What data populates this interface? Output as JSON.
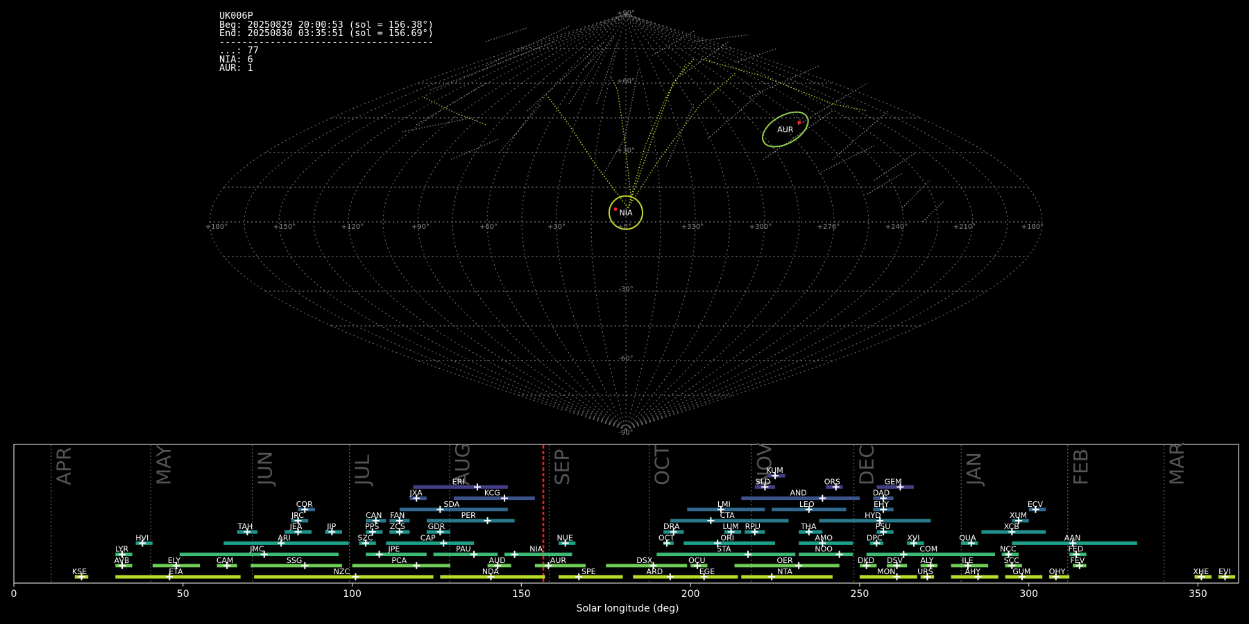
{
  "header": {
    "station": "UK006P",
    "begin": "Beg: 20250829 20:00:53 (sol = 156.38°)",
    "end": "End: 20250830 03:35:51 (sol = 156.69°)",
    "separator": "--------------------------------------",
    "counts": [
      {
        "label": "...",
        "value": 77
      },
      {
        "label": "NIA",
        "value": 6
      },
      {
        "label": "AUR",
        "value": 1
      }
    ]
  },
  "chart_data": [
    {
      "type": "scatter",
      "projection": "sinusoidal",
      "lon_ticks": [
        "+180°",
        "+150°",
        "+120°",
        "+90°",
        "+60°",
        "+30°",
        "+0°",
        "+330°",
        "+300°",
        "+270°",
        "+240°",
        "+210°",
        "+180°"
      ],
      "lat_ticks": [
        "+90°",
        "+60°",
        "+30°",
        "-30°",
        "-60°",
        "-90°"
      ],
      "radiants": [
        {
          "name": "AUR",
          "lon": 90,
          "lat": 40,
          "color": "#8fd14f"
        },
        {
          "name": "NIA",
          "lon": 0,
          "lat": 4,
          "color": "#c8d62a"
        }
      ],
      "colors": {
        "trails_sporadic": "#8a8a8a",
        "trails_nia": "#c8d62a",
        "trails_aur": "#8fd14f",
        "start_point": "#ff2020"
      }
    },
    {
      "type": "timeline",
      "xlabel": "Solar longitude (deg)",
      "xlim": [
        0,
        362
      ],
      "xticks": [
        0,
        50,
        100,
        150,
        200,
        250,
        300,
        350
      ],
      "current_sol": 156.5,
      "months": [
        {
          "label": "APR",
          "start": 11
        },
        {
          "label": "MAY",
          "start": 40.5
        },
        {
          "label": "JUN",
          "start": 70.5
        },
        {
          "label": "JUL",
          "start": 99.2
        },
        {
          "label": "AUG",
          "start": 128.8
        },
        {
          "label": "SEP",
          "start": 158.2
        },
        {
          "label": "OCT",
          "start": 187.8
        },
        {
          "label": "NOV",
          "start": 218
        },
        {
          "label": "DEC",
          "start": 248.3
        },
        {
          "label": "JAN",
          "start": 280
        },
        {
          "label": "FEB",
          "start": 311.5
        },
        {
          "label": "MAR",
          "start": 340
        }
      ],
      "showers": [
        {
          "code": "KUM",
          "start": 223,
          "end": 228,
          "peak": 225,
          "row": 8,
          "color": "#433e85"
        },
        {
          "code": "ERI",
          "start": 118,
          "end": 146,
          "peak": 137,
          "row": 7,
          "color": "#433e85"
        },
        {
          "code": "SLD",
          "start": 219,
          "end": 225,
          "peak": 222,
          "row": 7,
          "color": "#433e85"
        },
        {
          "code": "ORS",
          "start": 240,
          "end": 245,
          "peak": 243,
          "row": 7,
          "color": "#433e85"
        },
        {
          "code": "GEM",
          "start": 255,
          "end": 266,
          "peak": 262,
          "row": 7,
          "color": "#433e85"
        },
        {
          "code": "JXA",
          "start": 117,
          "end": 122,
          "peak": 119,
          "row": 6,
          "color": "#3b528b"
        },
        {
          "code": "KCG",
          "start": 130,
          "end": 154,
          "peak": 145,
          "row": 6,
          "color": "#3b528b"
        },
        {
          "code": "AND",
          "start": 215,
          "end": 250,
          "peak": 239,
          "row": 6,
          "color": "#3b528b"
        },
        {
          "code": "DAD",
          "start": 254,
          "end": 260,
          "peak": 257,
          "row": 6,
          "color": "#3b528b"
        },
        {
          "code": "COR",
          "start": 84,
          "end": 89,
          "peak": 86,
          "row": 5,
          "color": "#31688e"
        },
        {
          "code": "SDA",
          "start": 114,
          "end": 146,
          "peak": 126,
          "row": 5,
          "color": "#31688e"
        },
        {
          "code": "LMI",
          "start": 199,
          "end": 222,
          "peak": 209,
          "row": 5,
          "color": "#31688e"
        },
        {
          "code": "LEO",
          "start": 224,
          "end": 246,
          "peak": 235,
          "row": 5,
          "color": "#31688e"
        },
        {
          "code": "EHY",
          "start": 254,
          "end": 260,
          "peak": 257,
          "row": 5,
          "color": "#31688e"
        },
        {
          "code": "ECV",
          "start": 300,
          "end": 305,
          "peak": 302,
          "row": 5,
          "color": "#31688e"
        },
        {
          "code": "JRC",
          "start": 82,
          "end": 87,
          "peak": 84,
          "row": 4,
          "color": "#287c8e"
        },
        {
          "code": "CAN",
          "start": 104,
          "end": 110,
          "peak": 107,
          "row": 4,
          "color": "#287c8e"
        },
        {
          "code": "FAN",
          "start": 111,
          "end": 117,
          "peak": 114,
          "row": 4,
          "color": "#287c8e"
        },
        {
          "code": "PER",
          "start": 122,
          "end": 148,
          "peak": 140,
          "row": 4,
          "color": "#287c8e"
        },
        {
          "code": "CTA",
          "start": 194,
          "end": 229,
          "peak": 206,
          "row": 4,
          "color": "#287c8e"
        },
        {
          "code": "HYD",
          "start": 238,
          "end": 271,
          "peak": 256,
          "row": 4,
          "color": "#287c8e"
        },
        {
          "code": "XUM",
          "start": 295,
          "end": 300,
          "peak": 297,
          "row": 4,
          "color": "#287c8e"
        },
        {
          "code": "TAH",
          "start": 66,
          "end": 72,
          "peak": 69,
          "row": 3,
          "color": "#21918c"
        },
        {
          "code": "JEA",
          "start": 80,
          "end": 88,
          "peak": 84,
          "row": 3,
          "color": "#21918c"
        },
        {
          "code": "JIP",
          "start": 92,
          "end": 97,
          "peak": 94,
          "row": 3,
          "color": "#21918c"
        },
        {
          "code": "PPS",
          "start": 104,
          "end": 109,
          "peak": 106,
          "row": 3,
          "color": "#21918c"
        },
        {
          "code": "ZCS",
          "start": 111,
          "end": 117,
          "peak": 114,
          "row": 3,
          "color": "#21918c"
        },
        {
          "code": "GDR",
          "start": 122,
          "end": 129,
          "peak": 126,
          "row": 3,
          "color": "#21918c"
        },
        {
          "code": "DRA",
          "start": 192,
          "end": 198,
          "peak": 195,
          "row": 3,
          "color": "#21918c"
        },
        {
          "code": "LUM",
          "start": 210,
          "end": 215,
          "peak": 212,
          "row": 3,
          "color": "#21918c"
        },
        {
          "code": "RPU",
          "start": 216,
          "end": 222,
          "peak": 219,
          "row": 3,
          "color": "#21918c"
        },
        {
          "code": "THA",
          "start": 232,
          "end": 239,
          "peak": 235,
          "row": 3,
          "color": "#21918c"
        },
        {
          "code": "PSU",
          "start": 255,
          "end": 260,
          "peak": 257,
          "row": 3,
          "color": "#21918c"
        },
        {
          "code": "XCB",
          "start": 286,
          "end": 305,
          "peak": 295,
          "row": 3,
          "color": "#21918c"
        },
        {
          "code": "HVI",
          "start": 36,
          "end": 41,
          "peak": 38,
          "row": 2,
          "color": "#1fa088"
        },
        {
          "code": "ARI",
          "start": 62,
          "end": 99,
          "peak": 79,
          "row": 2,
          "color": "#1fa088"
        },
        {
          "code": "SZC",
          "start": 102,
          "end": 107,
          "peak": 104,
          "row": 2,
          "color": "#1fa088"
        },
        {
          "code": "CAP",
          "start": 110,
          "end": 136,
          "peak": 127,
          "row": 2,
          "color": "#1fa088"
        },
        {
          "code": "NUE",
          "start": 161,
          "end": 166,
          "peak": 163,
          "row": 2,
          "color": "#1fa088"
        },
        {
          "code": "OCT",
          "start": 192,
          "end": 195,
          "peak": 193,
          "row": 2,
          "color": "#1fa088"
        },
        {
          "code": "ORI",
          "start": 198,
          "end": 225,
          "peak": 208,
          "row": 2,
          "color": "#1fa088"
        },
        {
          "code": "AMO",
          "start": 232,
          "end": 248,
          "peak": 239,
          "row": 2,
          "color": "#1fa088"
        },
        {
          "code": "DPC",
          "start": 253,
          "end": 257,
          "peak": 255,
          "row": 2,
          "color": "#1fa088"
        },
        {
          "code": "XVI",
          "start": 264,
          "end": 269,
          "peak": 266,
          "row": 2,
          "color": "#1fa088"
        },
        {
          "code": "QUA",
          "start": 280,
          "end": 285,
          "peak": 283,
          "row": 2,
          "color": "#1fa088"
        },
        {
          "code": "AAN",
          "start": 295,
          "end": 332,
          "peak": 313,
          "row": 2,
          "color": "#1fa088"
        },
        {
          "code": "LYR",
          "start": 30,
          "end": 35,
          "peak": 32,
          "row": 1,
          "color": "#3bbb75"
        },
        {
          "code": "JMC",
          "start": 49,
          "end": 96,
          "peak": 74,
          "row": 1,
          "color": "#3bbb75"
        },
        {
          "code": "JPE",
          "start": 104,
          "end": 122,
          "peak": 108,
          "row": 1,
          "color": "#3bbb75"
        },
        {
          "code": "PAU",
          "start": 124,
          "end": 143,
          "peak": 136,
          "row": 1,
          "color": "#3bbb75"
        },
        {
          "code": "NIA",
          "start": 145,
          "end": 165,
          "peak": 148,
          "row": 1,
          "color": "#3bbb75"
        },
        {
          "code": "STA",
          "start": 190,
          "end": 231,
          "peak": 217,
          "row": 1,
          "color": "#3bbb75"
        },
        {
          "code": "NOO",
          "start": 232,
          "end": 248,
          "peak": 244,
          "row": 1,
          "color": "#3bbb75"
        },
        {
          "code": "COM",
          "start": 252,
          "end": 290,
          "peak": 263,
          "row": 1,
          "color": "#3bbb75"
        },
        {
          "code": "NCC",
          "start": 292,
          "end": 297,
          "peak": 294,
          "row": 1,
          "color": "#3bbb75"
        },
        {
          "code": "FED",
          "start": 312,
          "end": 317,
          "peak": 314,
          "row": 1,
          "color": "#3bbb75"
        },
        {
          "code": "AVB",
          "start": 30,
          "end": 35,
          "peak": 32,
          "row": 0,
          "color": "#6ece58"
        },
        {
          "code": "ELY",
          "start": 41,
          "end": 55,
          "peak": 48,
          "row": 0,
          "color": "#6ece58"
        },
        {
          "code": "CAM",
          "start": 60,
          "end": 66,
          "peak": 63,
          "row": 0,
          "color": "#6ece58"
        },
        {
          "code": "SSG",
          "start": 70,
          "end": 97,
          "peak": 86,
          "row": 0,
          "color": "#6ece58"
        },
        {
          "code": "PCA",
          "start": 100,
          "end": 129,
          "peak": 119,
          "row": 0,
          "color": "#6ece58"
        },
        {
          "code": "AUD",
          "start": 140,
          "end": 147,
          "peak": 143,
          "row": 0,
          "color": "#6ece58"
        },
        {
          "code": "AUR",
          "start": 154,
          "end": 169,
          "peak": 158,
          "row": 0,
          "color": "#6ece58"
        },
        {
          "code": "DSX",
          "start": 175,
          "end": 199,
          "peak": 189,
          "row": 0,
          "color": "#6ece58"
        },
        {
          "code": "OCU",
          "start": 200,
          "end": 205,
          "peak": 202,
          "row": 0,
          "color": "#6ece58"
        },
        {
          "code": "OER",
          "start": 213,
          "end": 244,
          "peak": 232,
          "row": 0,
          "color": "#6ece58"
        },
        {
          "code": "DKD",
          "start": 250,
          "end": 255,
          "peak": 252,
          "row": 0,
          "color": "#6ece58"
        },
        {
          "code": "DSV",
          "start": 258,
          "end": 264,
          "peak": 261,
          "row": 0,
          "color": "#6ece58"
        },
        {
          "code": "ALY",
          "start": 268,
          "end": 273,
          "peak": 271,
          "row": 0,
          "color": "#6ece58"
        },
        {
          "code": "ILE",
          "start": 277,
          "end": 288,
          "peak": 282,
          "row": 0,
          "color": "#6ece58"
        },
        {
          "code": "SCC",
          "start": 293,
          "end": 298,
          "peak": 295,
          "row": 0,
          "color": "#6ece58"
        },
        {
          "code": "FEV",
          "start": 313,
          "end": 317,
          "peak": 315,
          "row": 0,
          "color": "#6ece58"
        },
        {
          "code": "KSE",
          "start": 18,
          "end": 22,
          "peak": 20,
          "row": -1,
          "color": "#b5de2b"
        },
        {
          "code": "ETA",
          "start": 30,
          "end": 67,
          "peak": 46,
          "row": -1,
          "color": "#b5de2b"
        },
        {
          "code": "NZC",
          "start": 71,
          "end": 124,
          "peak": 101,
          "row": -1,
          "color": "#b5de2b"
        },
        {
          "code": "NDA",
          "start": 126,
          "end": 157,
          "peak": 141,
          "row": -1,
          "color": "#b5de2b"
        },
        {
          "code": "SPE",
          "start": 161,
          "end": 180,
          "peak": 167,
          "row": -1,
          "color": "#b5de2b"
        },
        {
          "code": "ARD",
          "start": 183,
          "end": 197,
          "peak": 194,
          "row": -1,
          "color": "#b5de2b"
        },
        {
          "code": "EGE",
          "start": 197,
          "end": 214,
          "peak": 204,
          "row": -1,
          "color": "#b5de2b"
        },
        {
          "code": "NTA",
          "start": 215,
          "end": 242,
          "peak": 224,
          "row": -1,
          "color": "#b5de2b"
        },
        {
          "code": "MON",
          "start": 250,
          "end": 267,
          "peak": 261,
          "row": -1,
          "color": "#b5de2b"
        },
        {
          "code": "URS",
          "start": 268,
          "end": 272,
          "peak": 270,
          "row": -1,
          "color": "#b5de2b"
        },
        {
          "code": "AHY",
          "start": 277,
          "end": 291,
          "peak": 285,
          "row": -1,
          "color": "#b5de2b"
        },
        {
          "code": "GUM",
          "start": 293,
          "end": 304,
          "peak": 298,
          "row": -1,
          "color": "#b5de2b"
        },
        {
          "code": "OHY",
          "start": 306,
          "end": 312,
          "peak": 308,
          "row": -1,
          "color": "#b5de2b"
        },
        {
          "code": "XHE",
          "start": 349,
          "end": 354,
          "peak": 351,
          "row": -1,
          "color": "#b5de2b"
        },
        {
          "code": "EVI",
          "start": 356,
          "end": 361,
          "peak": 358,
          "row": -1,
          "color": "#b5de2b"
        }
      ]
    }
  ]
}
